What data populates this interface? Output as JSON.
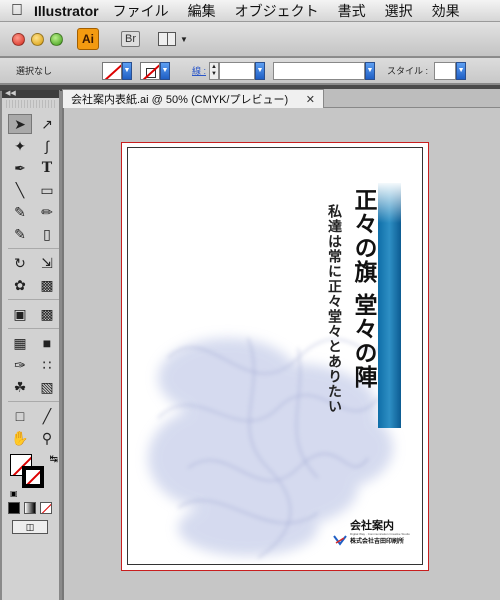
{
  "menubar": {
    "app_name": "Illustrator",
    "items": [
      "ファイル",
      "編集",
      "オブジェクト",
      "書式",
      "選択",
      "効果"
    ]
  },
  "appbar": {
    "logo_text": "Ai",
    "bridge_label": "Br"
  },
  "controlbar": {
    "selection_label": "選択なし",
    "stroke_label": "線 :",
    "style_label": "スタイル :"
  },
  "document": {
    "tab_title": "会社案内表紙.ai @ 50% (CMYK/プレビュー)",
    "close_glyph": "✕"
  },
  "artwork": {
    "title": "正々の旗 堂々の陣",
    "subtitle": "私達は常に正々堂々とありたい",
    "company_title": "会社案内",
    "printer_name": "株式会社吉田印刷所",
    "tagline": "Digital Way · Communication Creative Studio"
  },
  "colors": {
    "bleed_guide": "#c81e1e",
    "title_bar": "#1f7fb8",
    "smoke": "#b7bfe0"
  }
}
